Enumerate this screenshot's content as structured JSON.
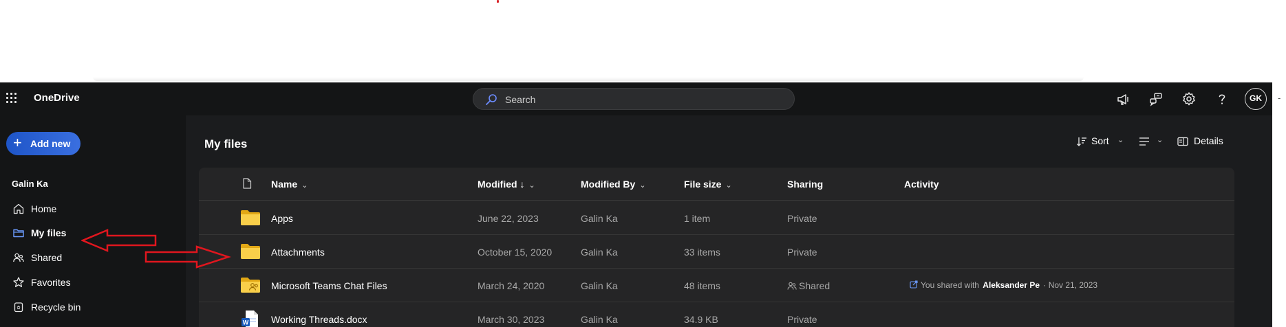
{
  "header": {
    "app_name": "OneDrive",
    "search_placeholder": "Search",
    "avatar_initials": "GK",
    "icons": [
      "waffle-icon",
      "search-icon",
      "megaphone-icon",
      "feedback-icon",
      "gear-icon",
      "help-icon"
    ]
  },
  "sidebar": {
    "add_new_label": "Add new",
    "user_name": "Galin Ka",
    "items": [
      {
        "label": "Home",
        "icon": "home-icon"
      },
      {
        "label": "My files",
        "icon": "folder-icon",
        "active": true
      },
      {
        "label": "Shared",
        "icon": "people-icon"
      },
      {
        "label": "Favorites",
        "icon": "star-icon"
      },
      {
        "label": "Recycle bin",
        "icon": "recycle-bin-icon"
      }
    ]
  },
  "main": {
    "title": "My files",
    "toolbar": {
      "sort_label": "Sort",
      "details_label": "Details"
    },
    "columns": {
      "name": "Name",
      "modified": "Modified",
      "modified_sort": "↓",
      "modified_by": "Modified By",
      "file_size": "File size",
      "sharing": "Sharing",
      "activity": "Activity"
    },
    "rows": [
      {
        "name": "Apps",
        "modified": "June 22, 2023",
        "modified_by": "Galin Ka",
        "size": "1 item",
        "sharing": "Private",
        "type": "folder"
      },
      {
        "name": "Attachments",
        "modified": "October 15, 2020",
        "modified_by": "Galin Ka",
        "size": "33 items",
        "sharing": "Private",
        "type": "folder"
      },
      {
        "name": "Microsoft Teams Chat Files",
        "modified": "March 24, 2020",
        "modified_by": "Galin Ka",
        "size": "48 items",
        "sharing": "Shared",
        "type": "shared-folder",
        "activity": {
          "prefix": "You shared with",
          "person": "Aleksander Pe",
          "date": "· Nov 21, 2023"
        }
      },
      {
        "name": "Working Threads.docx",
        "modified": "March 30, 2023",
        "modified_by": "Galin Ka",
        "size": "34.9 KB",
        "sharing": "Private",
        "type": "word-doc"
      }
    ]
  },
  "colors": {
    "accent": "#1e55c8",
    "folder": "#f7c948",
    "annotation_arrow": "#e0161e",
    "app_bg": "#141516"
  }
}
